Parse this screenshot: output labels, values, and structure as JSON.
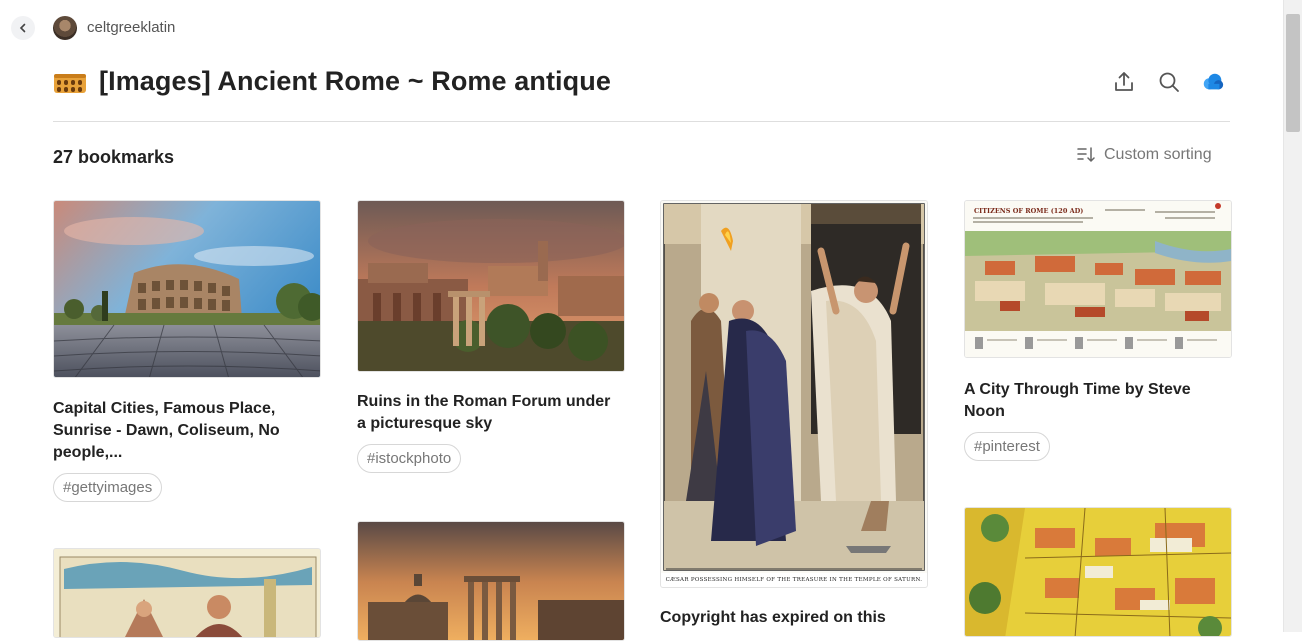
{
  "topbar": {
    "username": "celtgreeklatin"
  },
  "header": {
    "title": "[Images] Ancient Rome ~ Rome antique"
  },
  "toolbar": {
    "count": "27 bookmarks",
    "sort_label": "Custom sorting"
  },
  "cards": [
    {
      "title": "Capital Cities, Famous Place, Sunrise - Dawn, Coliseum, No people,...",
      "tag": "#gettyimages"
    },
    {
      "title": "Ruins in the Roman Forum under a picturesque sky",
      "tag": "#istockphoto"
    },
    {
      "title": "Copyright has expired on this",
      "caption": "CÆSAR POSSESSING HIMSELF OF THE TREASURE IN THE TEMPLE OF SATURN."
    },
    {
      "title": "A City Through Time by Steve Noon",
      "tag": "#pinterest",
      "thumb_heading": "CITIZENS OF ROME (120 AD)"
    }
  ],
  "colors": {
    "accent_blue": "#1e88e5",
    "icon_gray": "#555555"
  }
}
